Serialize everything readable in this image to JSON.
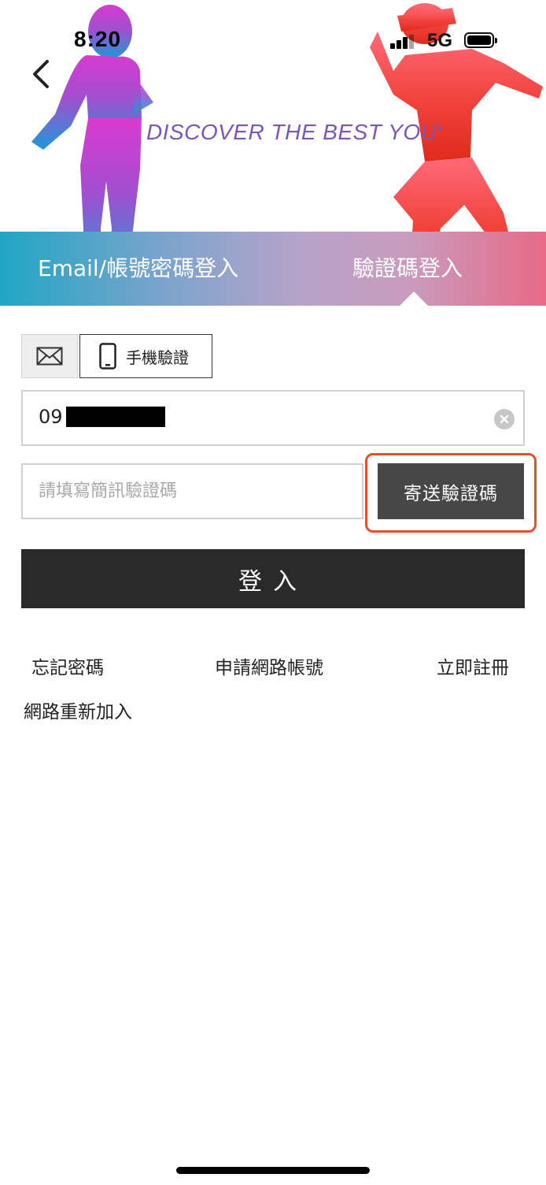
{
  "status_bar": {
    "time": "8:20",
    "network": "5G"
  },
  "hero": {
    "tagline": "DISCOVER THE BEST YOU",
    "tagline_mark": "®"
  },
  "tabs": [
    {
      "label": "Email/帳號密碼登入",
      "active": false
    },
    {
      "label": "驗證碼登入",
      "active": true
    }
  ],
  "method_toggle": {
    "email_icon": "envelope-icon",
    "phone_icon": "phone-icon",
    "phone_label": "手機驗證"
  },
  "phone_field": {
    "value_visible": "09",
    "value_redacted": true
  },
  "code_field": {
    "placeholder": "請填寫簡訊驗證碼",
    "value": ""
  },
  "send_button": {
    "label": "寄送驗證碼"
  },
  "login_button": {
    "label": "登入"
  },
  "links": {
    "forgot_password": "忘記密碼",
    "apply_online_account": "申請網路帳號",
    "register_now": "立即註冊",
    "rejoin_online": "網路重新加入"
  },
  "colors": {
    "accent_highlight": "#e2532d",
    "button_dark": "#2a2a2a",
    "send_button": "#474747",
    "tagline": "#7b55b8"
  }
}
